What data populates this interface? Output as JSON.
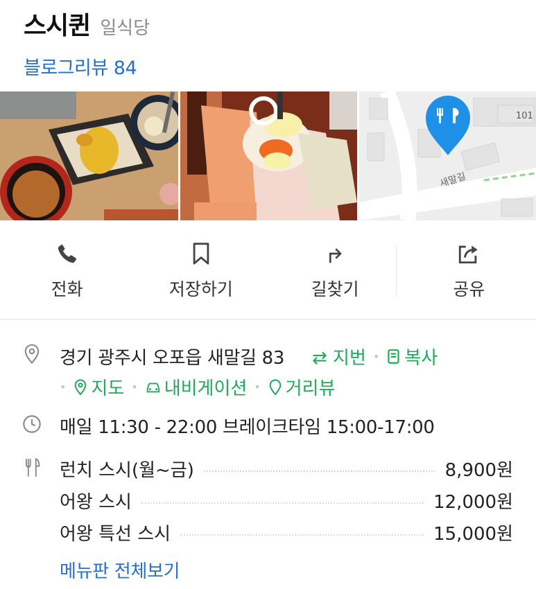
{
  "place": {
    "name": "스시퀸",
    "category": "일식당",
    "blog_review": "블로그리뷰 84"
  },
  "map": {
    "road_label": "새말길",
    "building_number": "101"
  },
  "actions": [
    {
      "label": "전화",
      "icon": "phone-icon"
    },
    {
      "label": "저장하기",
      "icon": "bookmark-icon"
    },
    {
      "label": "길찾기",
      "icon": "directions-icon"
    },
    {
      "label": "공유",
      "icon": "share-icon"
    }
  ],
  "address": {
    "text": "경기 광주시 오포읍 새말길 83",
    "lot_number_label": "⇄ 지번",
    "copy_label": "복사",
    "map_label": "지도",
    "navigation_label": "내비게이션",
    "street_view_label": "거리뷰"
  },
  "hours": {
    "text": "매일 11:30 - 22:00 브레이크타임 15:00-17:00"
  },
  "menu": {
    "items": [
      {
        "name": "런치 스시(월~금)",
        "price": "8,900원"
      },
      {
        "name": "어왕 스시",
        "price": "12,000원"
      },
      {
        "name": "어왕 특선 스시",
        "price": "15,000원"
      }
    ],
    "view_all_label": "메뉴판 전체보기"
  },
  "colors": {
    "link_blue": "#2570c9",
    "link_green": "#1faa5a",
    "map_pin_blue": "#1e90e8"
  }
}
